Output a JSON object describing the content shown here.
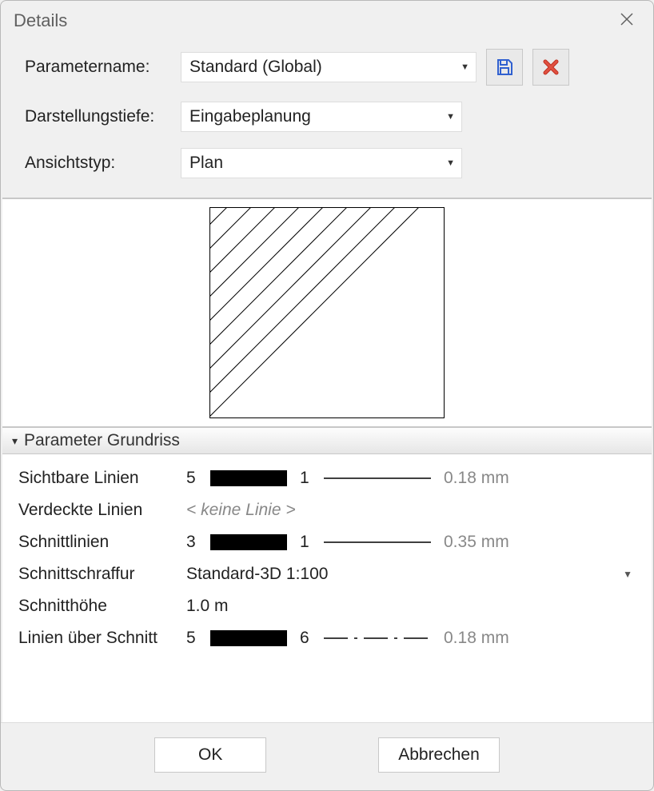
{
  "titlebar": {
    "title": "Details"
  },
  "form": {
    "parameter_name_label": "Parametername:",
    "parameter_name_value": "Standard (Global)",
    "display_depth_label": "Darstellungstiefe:",
    "display_depth_value": "Eingabeplanung",
    "view_type_label": "Ansichtstyp:",
    "view_type_value": "Plan"
  },
  "icons": {
    "save": "save-icon",
    "delete": "delete-icon"
  },
  "section": {
    "title": "Parameter Grundriss"
  },
  "params": {
    "visible_lines": {
      "label": "Sichtbare Linien",
      "color_idx": "5",
      "style_idx": "1",
      "thickness": "0.18 mm"
    },
    "hidden_lines": {
      "label": "Verdeckte Linien",
      "no_line": "< keine Linie >"
    },
    "section_lines": {
      "label": "Schnittlinien",
      "color_idx": "3",
      "style_idx": "1",
      "thickness": "0.35 mm"
    },
    "section_hatch": {
      "label": "Schnittschraffur",
      "value": "Standard-3D 1:100"
    },
    "section_height": {
      "label": "Schnitthöhe",
      "value": "1.0 m"
    },
    "lines_above": {
      "label": "Linien über Schnitt",
      "color_idx": "5",
      "style_idx": "6",
      "thickness": "0.18 mm"
    }
  },
  "buttons": {
    "ok": "OK",
    "cancel": "Abbrechen"
  }
}
